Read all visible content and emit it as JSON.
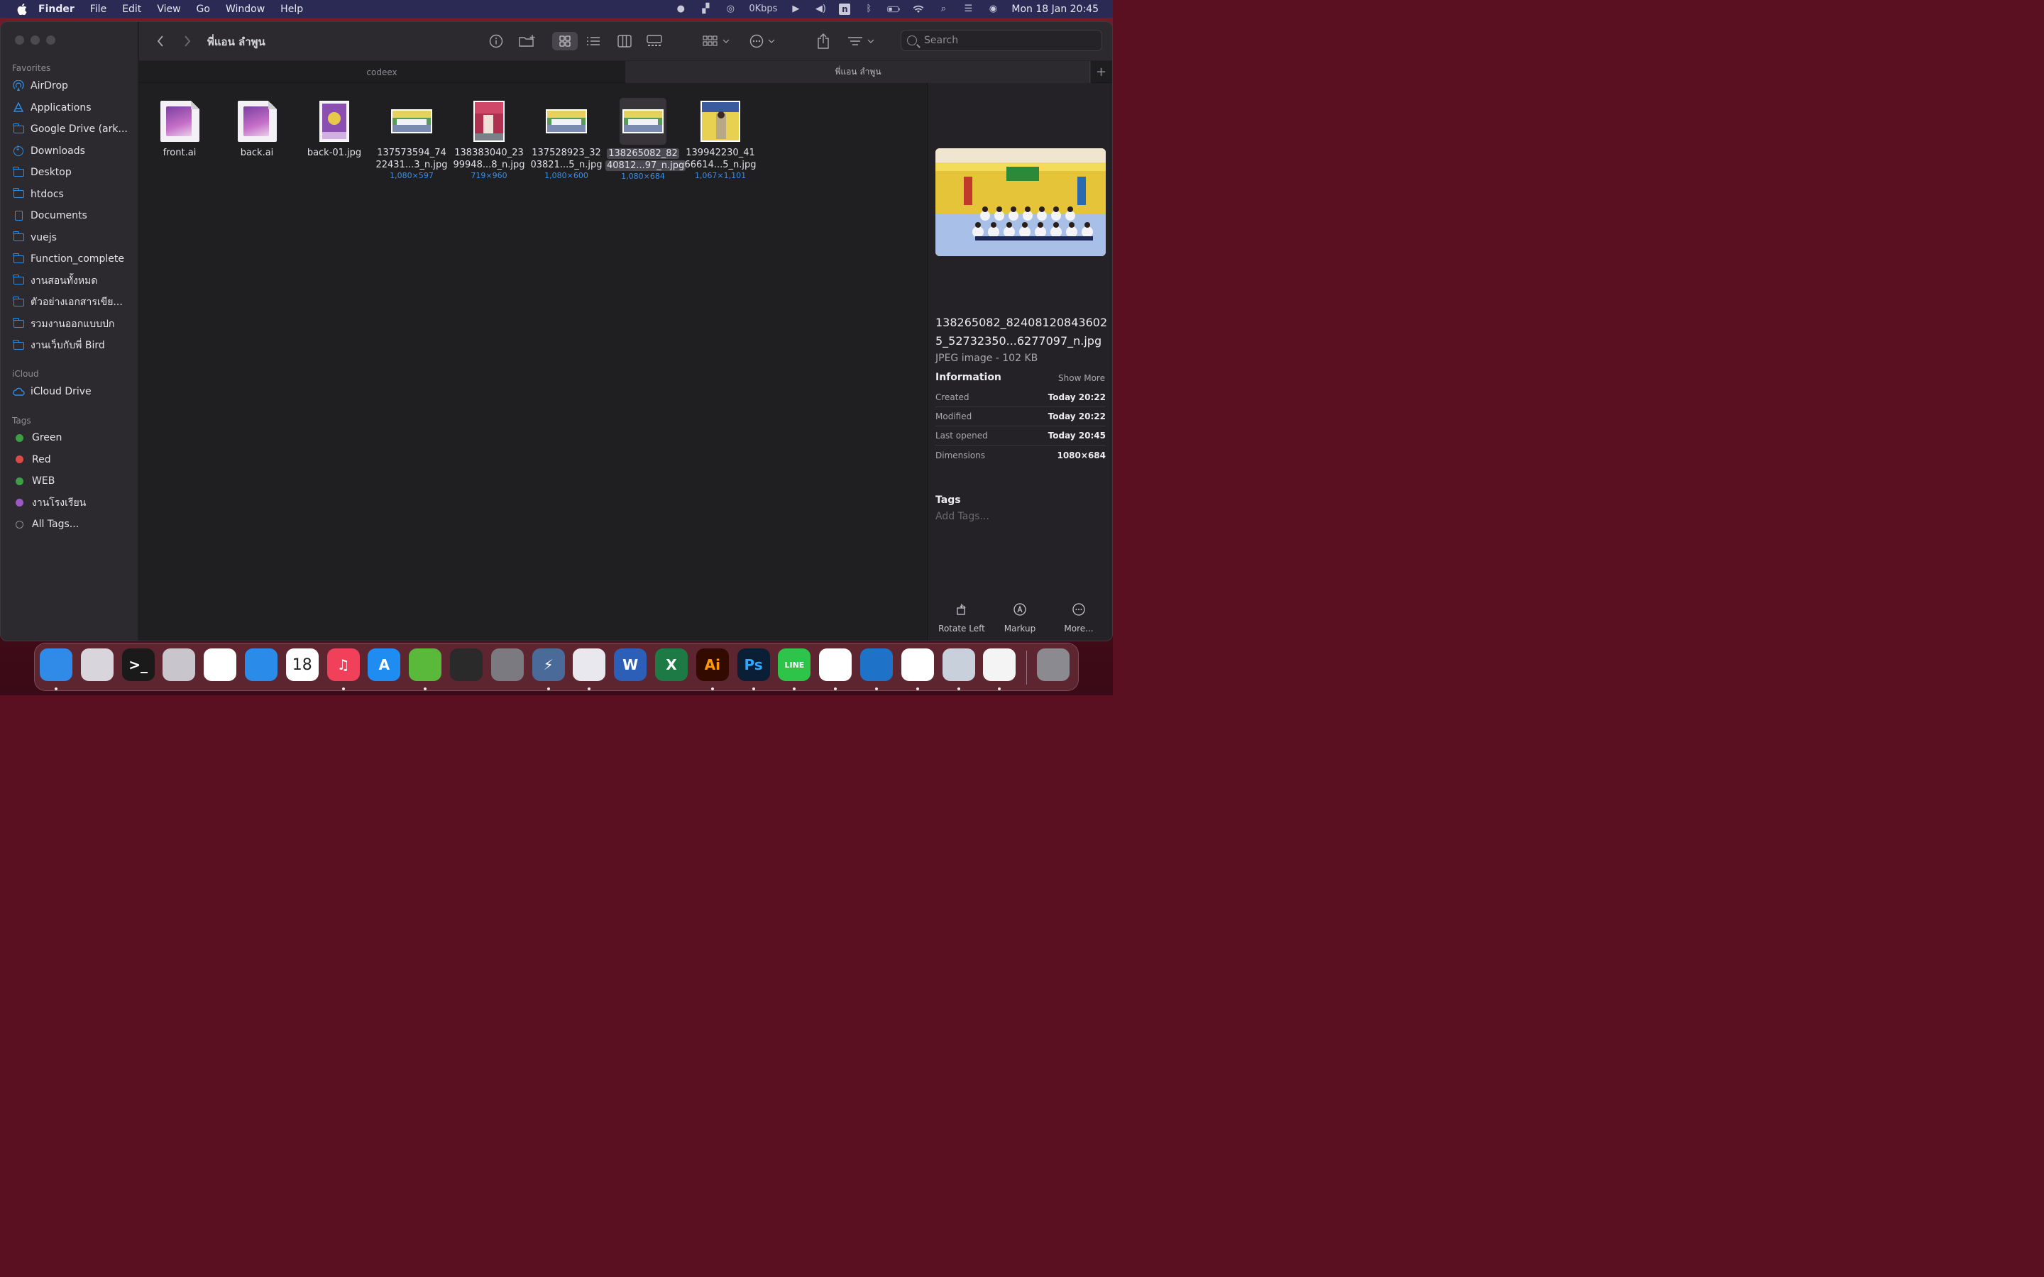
{
  "menubar": {
    "app": "Finder",
    "items": [
      "File",
      "Edit",
      "View",
      "Go",
      "Window",
      "Help"
    ],
    "network": "0Kbps",
    "n_badge": "n",
    "datetime": "Mon 18 Jan  20:45"
  },
  "window": {
    "title": "พี่แอน ลำพูน",
    "search_placeholder": "Search",
    "tabs": [
      {
        "label": "codeex",
        "active": false
      },
      {
        "label": "พี่แอน ลำพูน",
        "active": true
      }
    ],
    "add_tab": "+"
  },
  "sidebar": {
    "favorites_label": "Favorites",
    "favorites": [
      {
        "label": "AirDrop",
        "icon": "airdrop-icon"
      },
      {
        "label": "Applications",
        "icon": "applications-icon"
      },
      {
        "label": "Google Drive (ark...",
        "icon": "folder-icon"
      },
      {
        "label": "Downloads",
        "icon": "downloads-icon"
      },
      {
        "label": "Desktop",
        "icon": "folder-icon"
      },
      {
        "label": "htdocs",
        "icon": "folder-icon"
      },
      {
        "label": "Documents",
        "icon": "document-icon"
      },
      {
        "label": "vuejs",
        "icon": "folder-icon"
      },
      {
        "label": "Function_complete",
        "icon": "folder-icon"
      },
      {
        "label": "งานสอนทั้งหมด",
        "icon": "folder-icon"
      },
      {
        "label": "ตัวอย่างเอกสารเขีย...",
        "icon": "folder-icon"
      },
      {
        "label": "รวมงานออกแบบปก",
        "icon": "folder-icon"
      },
      {
        "label": "งานเว็บกับพี่ Bird",
        "icon": "folder-icon"
      }
    ],
    "icloud_label": "iCloud",
    "icloud": [
      {
        "label": "iCloud Drive",
        "icon": "cloud-icon"
      }
    ],
    "tags_label": "Tags",
    "tags": [
      {
        "label": "Green",
        "color": "#3e9e47"
      },
      {
        "label": "Red",
        "color": "#d84b47"
      },
      {
        "label": "WEB",
        "color": "#3e9e47"
      },
      {
        "label": "งานโรงเรียน",
        "color": "#9b59c2"
      },
      {
        "label": "All Tags...",
        "color": ""
      }
    ]
  },
  "files": [
    {
      "name1": "front.ai",
      "name2": "",
      "dims": "",
      "kind": "ai"
    },
    {
      "name1": "back.ai",
      "name2": "",
      "dims": "",
      "kind": "ai"
    },
    {
      "name1": "back-01.jpg",
      "name2": "",
      "dims": "",
      "kind": "jpg-poster"
    },
    {
      "name1": "137573594_74",
      "name2": "22431...3_n.jpg",
      "dims": "1,080×597",
      "kind": "jpg-wide"
    },
    {
      "name1": "138383040_23",
      "name2": "99948...8_n.jpg",
      "dims": "719×960",
      "kind": "jpg-tall"
    },
    {
      "name1": "137528923_32",
      "name2": "03821...5_n.jpg",
      "dims": "1,080×600",
      "kind": "jpg-wide"
    },
    {
      "name1": "138265082_82",
      "name2": "40812...97_n.jpg",
      "dims": "1,080×684",
      "kind": "jpg-wide",
      "selected": true
    },
    {
      "name1": "139942230_41",
      "name2": "66614...5_n.jpg",
      "dims": "1,067×1,101",
      "kind": "jpg-square"
    }
  ],
  "preview": {
    "filename": "138265082_824081208436025_52732350...6277097_n.jpg",
    "kind": "JPEG image - 102 KB",
    "information": "Information",
    "show_more": "Show More",
    "rows": [
      {
        "k": "Created",
        "v": "Today 20:22"
      },
      {
        "k": "Modified",
        "v": "Today 20:22"
      },
      {
        "k": "Last opened",
        "v": "Today 20:45"
      },
      {
        "k": "Dimensions",
        "v": "1080×684"
      }
    ],
    "tags": "Tags",
    "add_tags": "Add Tags...",
    "actions": [
      "Rotate Left",
      "Markup",
      "More..."
    ]
  },
  "dock": {
    "apps": [
      {
        "name": "finder",
        "label": "",
        "bg": "#2f8ae8",
        "dot": true
      },
      {
        "name": "launchpad",
        "label": "",
        "bg": "#d8d6dc",
        "dot": false
      },
      {
        "name": "terminal",
        "label": ">_",
        "bg": "#1a1a1a",
        "dot": false
      },
      {
        "name": "calculator",
        "label": "",
        "bg": "#c8c6cc",
        "dot": false
      },
      {
        "name": "photos",
        "label": "",
        "bg": "#ffffff",
        "dot": false
      },
      {
        "name": "safari",
        "label": "",
        "bg": "#2a8ce8",
        "dot": false
      },
      {
        "name": "calendar",
        "label": "18",
        "bg": "#ffffff",
        "dot": false
      },
      {
        "name": "music",
        "label": "♫",
        "bg": "#f0405a",
        "dot": true
      },
      {
        "name": "app-store",
        "label": "A",
        "bg": "#1e8cf0",
        "dot": false
      },
      {
        "name": "tunnel",
        "label": "",
        "bg": "#5ab83a",
        "dot": true
      },
      {
        "name": "istat",
        "label": "",
        "bg": "#2a2a2a",
        "dot": false
      },
      {
        "name": "system-preferences",
        "label": "",
        "bg": "#7a7a80",
        "dot": false
      },
      {
        "name": "reeder",
        "label": "⚡",
        "bg": "#4a6a9a",
        "dot": true
      },
      {
        "name": "settings",
        "label": "",
        "bg": "#e8e8ee",
        "dot": true
      },
      {
        "name": "word",
        "label": "W",
        "bg": "#2b5fb8",
        "dot": false
      },
      {
        "name": "excel",
        "label": "X",
        "bg": "#1d7a44",
        "dot": false
      },
      {
        "name": "illustrator",
        "label": "Ai",
        "bg": "#330a00",
        "dot": true
      },
      {
        "name": "photoshop",
        "label": "Ps",
        "bg": "#0a1e36",
        "dot": true
      },
      {
        "name": "line",
        "label": "LINE",
        "bg": "#2ec44a",
        "dot": true
      },
      {
        "name": "messenger",
        "label": "",
        "bg": "#ffffff",
        "dot": true
      },
      {
        "name": "vscode",
        "label": "",
        "bg": "#1e72c8",
        "dot": true
      },
      {
        "name": "chrome",
        "label": "",
        "bg": "#ffffff",
        "dot": true
      },
      {
        "name": "preview",
        "label": "",
        "bg": "#c8d0dc",
        "dot": true
      },
      {
        "name": "textedit",
        "label": "",
        "bg": "#f4f4f4",
        "dot": true
      },
      {
        "name": "trash",
        "label": "",
        "bg": "#8a8a90",
        "dot": false
      }
    ]
  }
}
